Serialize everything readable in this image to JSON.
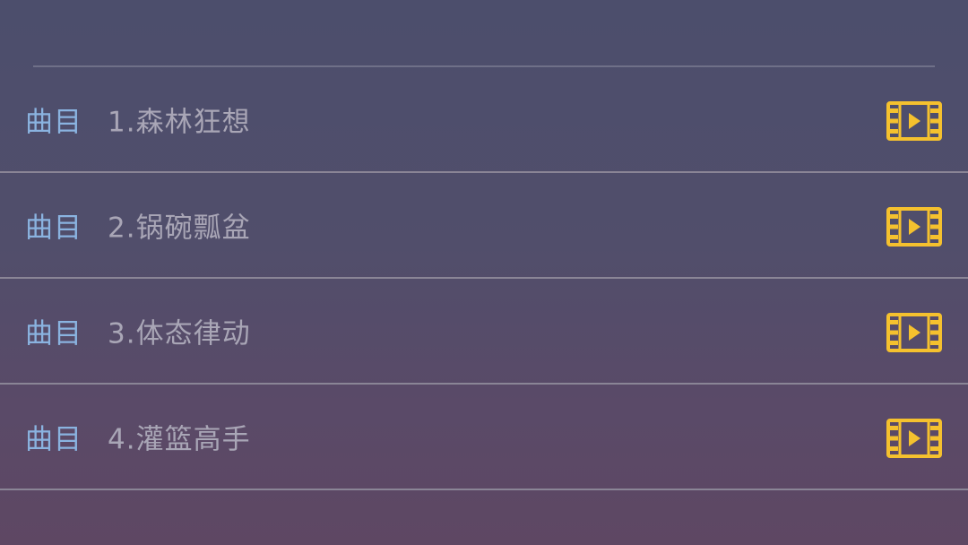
{
  "colors": {
    "tag": "#8ab3e0",
    "title": "#a9a6b6",
    "icon": "#f5c12e",
    "divider": "#8a8596"
  },
  "tracks": [
    {
      "tag": "曲目",
      "title": "1.森林狂想",
      "icon": "video-play-icon"
    },
    {
      "tag": "曲目",
      "title": "2.锅碗瓢盆",
      "icon": "video-play-icon"
    },
    {
      "tag": "曲目",
      "title": "3.体态律动",
      "icon": "video-play-icon"
    },
    {
      "tag": "曲目",
      "title": "4.灌篮高手",
      "icon": "video-play-icon"
    }
  ]
}
